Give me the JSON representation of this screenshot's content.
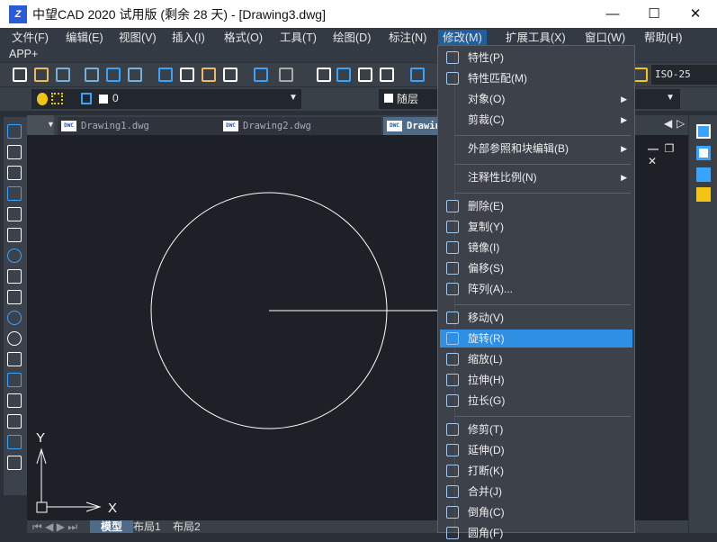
{
  "window": {
    "title": "中望CAD 2020 试用版 (剩余 28 天) - [Drawing3.dwg]",
    "minimize": "—",
    "maximize": "☐",
    "close": "✕"
  },
  "menubar": {
    "items": [
      "文件(F)",
      "编辑(E)",
      "视图(V)",
      "插入(I)",
      "格式(O)",
      "工具(T)",
      "绘图(D)",
      "标注(N)",
      "修改(M)",
      "扩展工具(X)",
      "窗口(W)",
      "帮助(H)"
    ],
    "row2": "APP+",
    "active": "修改(M)"
  },
  "toolbar": {
    "layer_value": "0",
    "color_value": "随层",
    "dimstyle_value": "ISO-25"
  },
  "doc_tabs": [
    "Drawing1.dwg",
    "Drawing2.dwg",
    "Drawing3.dwg"
  ],
  "doc_tab_icon": "DWC",
  "layout_tabs": [
    "模型",
    "布局1",
    "布局2"
  ],
  "ucs": {
    "x": "X",
    "y": "Y"
  },
  "modify_menu": {
    "items": [
      {
        "label": "特性(P)",
        "icon": "properties-icon"
      },
      {
        "label": "特性匹配(M)",
        "icon": "match-properties-icon"
      },
      {
        "label": "对象(O)",
        "submenu": true
      },
      {
        "label": "剪裁(C)",
        "submenu": true
      },
      {
        "sep": true
      },
      {
        "label": "外部参照和块编辑(B)",
        "submenu": true
      },
      {
        "sep": true
      },
      {
        "label": "注释性比例(N)",
        "submenu": true
      },
      {
        "sep": true
      },
      {
        "label": "删除(E)",
        "icon": "erase-icon"
      },
      {
        "label": "复制(Y)",
        "icon": "copy-icon"
      },
      {
        "label": "镜像(I)",
        "icon": "mirror-icon"
      },
      {
        "label": "偏移(S)",
        "icon": "offset-icon"
      },
      {
        "label": "阵列(A)...",
        "icon": "array-icon"
      },
      {
        "sep": true
      },
      {
        "label": "移动(V)",
        "icon": "move-icon"
      },
      {
        "label": "旋转(R)",
        "icon": "rotate-icon",
        "highlighted": true
      },
      {
        "label": "缩放(L)",
        "icon": "scale-icon"
      },
      {
        "label": "拉伸(H)",
        "icon": "stretch-icon"
      },
      {
        "label": "拉长(G)",
        "icon": "lengthen-icon"
      },
      {
        "sep": true
      },
      {
        "label": "修剪(T)",
        "icon": "trim-icon"
      },
      {
        "label": "延伸(D)",
        "icon": "extend-icon"
      },
      {
        "label": "打断(K)",
        "icon": "break-icon"
      },
      {
        "label": "合并(J)",
        "icon": "join-icon"
      },
      {
        "label": "倒角(C)",
        "icon": "chamfer-icon"
      },
      {
        "label": "圆角(F)",
        "icon": "fillet-icon"
      }
    ]
  },
  "colors": {
    "highlight": "#2e8fe3",
    "canvas": "#1d2026",
    "menu": "#3c414a"
  }
}
